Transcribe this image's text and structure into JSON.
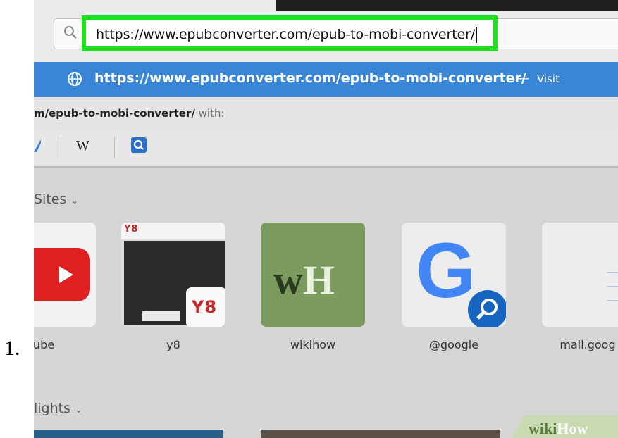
{
  "step": {
    "number": "1."
  },
  "browser": {
    "address_value": "https://www.epubconverter.com/epub-to-mobi-converter/",
    "highlight_color": "#1fe21f",
    "suggestion": {
      "url": "https://www.epubconverter.com/epub-to-mobi-converter/",
      "separator": "—",
      "action": "Visit",
      "color": "#3a86d6"
    },
    "search_with": {
      "url_fragment": "m/epub-to-mobi-converter/",
      "suffix": "with:"
    },
    "engines": [
      {
        "icon": "partial-engine-icon"
      },
      {
        "label": "W",
        "icon": "wikipedia-icon"
      },
      {
        "icon": "search-icon"
      }
    ]
  },
  "top_sites": {
    "title": "Sites",
    "tiles": [
      {
        "label": "ube",
        "icon": "youtube-icon"
      },
      {
        "label": "y8",
        "thumb_text": "Y8"
      },
      {
        "label": "wikihow",
        "logo_w": "w",
        "logo_h": "H"
      },
      {
        "label": "@google",
        "logo": "G"
      },
      {
        "label": "mail.goog"
      }
    ]
  },
  "highlights": {
    "title": "lights"
  },
  "watermark": {
    "wiki": "wiki",
    "how": "How"
  }
}
